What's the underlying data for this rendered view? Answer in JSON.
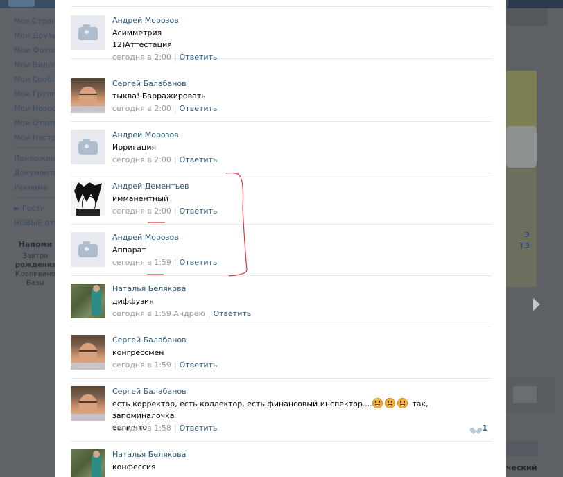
{
  "background": {
    "menu": [
      "Моя Страни",
      "Мои Друзья",
      "Мои Фотогр",
      "Мои Видеоз",
      "Мои Сообщ",
      "Мои Группы",
      "Мои Новост",
      "Мои Ответы",
      "Мои Настро"
    ],
    "menu2": [
      "Приложен",
      "Документы",
      "Реклама"
    ],
    "menu3": [
      "► Гости",
      "НОВЫЕ откр"
    ],
    "reminder_title": "Напоми",
    "reminder_lines": [
      "Завтра",
      "рождения",
      "Крапивино",
      "Базы"
    ],
    "ad_text": [
      "э",
      "тэ"
    ],
    "right_cut_text": "ческий"
  },
  "comments": [
    {
      "author": "Андрей Морозов",
      "lines": [
        "Асимметрия",
        "12)Аттестация"
      ],
      "time": "сегодня в 2:00",
      "reply": "Ответить",
      "avatar": "camera-icon"
    },
    {
      "author": "Сергей Балабанов",
      "lines": [
        "тыква! Барражировать"
      ],
      "time": "сегодня в 2:00",
      "reply": "Ответить",
      "avatar": "photo"
    },
    {
      "author": "Андрей Морозов",
      "lines": [
        "Ирригация"
      ],
      "time": "сегодня в 2:00",
      "reply": "Ответить",
      "avatar": "camera-icon"
    },
    {
      "author": "Андрей Дементьев",
      "lines": [
        "имманентный"
      ],
      "time": "сегодня в 2:00",
      "reply": "Ответить",
      "avatar": "photo"
    },
    {
      "author": "Андрей Морозов",
      "lines": [
        "Аппарат"
      ],
      "time": "сегодня в 1:59",
      "reply": "Ответить",
      "avatar": "camera-icon"
    },
    {
      "author": "Наталья Белякова",
      "lines": [
        "диффузия"
      ],
      "time": "сегодня в 1:59",
      "ref": "Андрею",
      "reply": "Ответить",
      "avatar": "photo"
    },
    {
      "author": "Сергей Балабанов",
      "lines": [
        "конгрессмен"
      ],
      "time": "сегодня в 1:59",
      "reply": "Ответить",
      "avatar": "photo"
    },
    {
      "author": "Сергей Балабанов",
      "line1_before": "есть корректор, есть коллектор, есть финансовый инспектор....",
      "line1_after": "так, запоминалочка",
      "line2": "если что",
      "time": "сегодня в 1:58",
      "reply": "Ответить",
      "likes": "1",
      "avatar": "photo"
    },
    {
      "author": "Наталья Белякова",
      "lines": [
        "конфессия"
      ],
      "avatar": "photo"
    }
  ],
  "colors": {
    "link": "#2b587a",
    "meta": "#999999",
    "annotation": "#e0303a"
  }
}
